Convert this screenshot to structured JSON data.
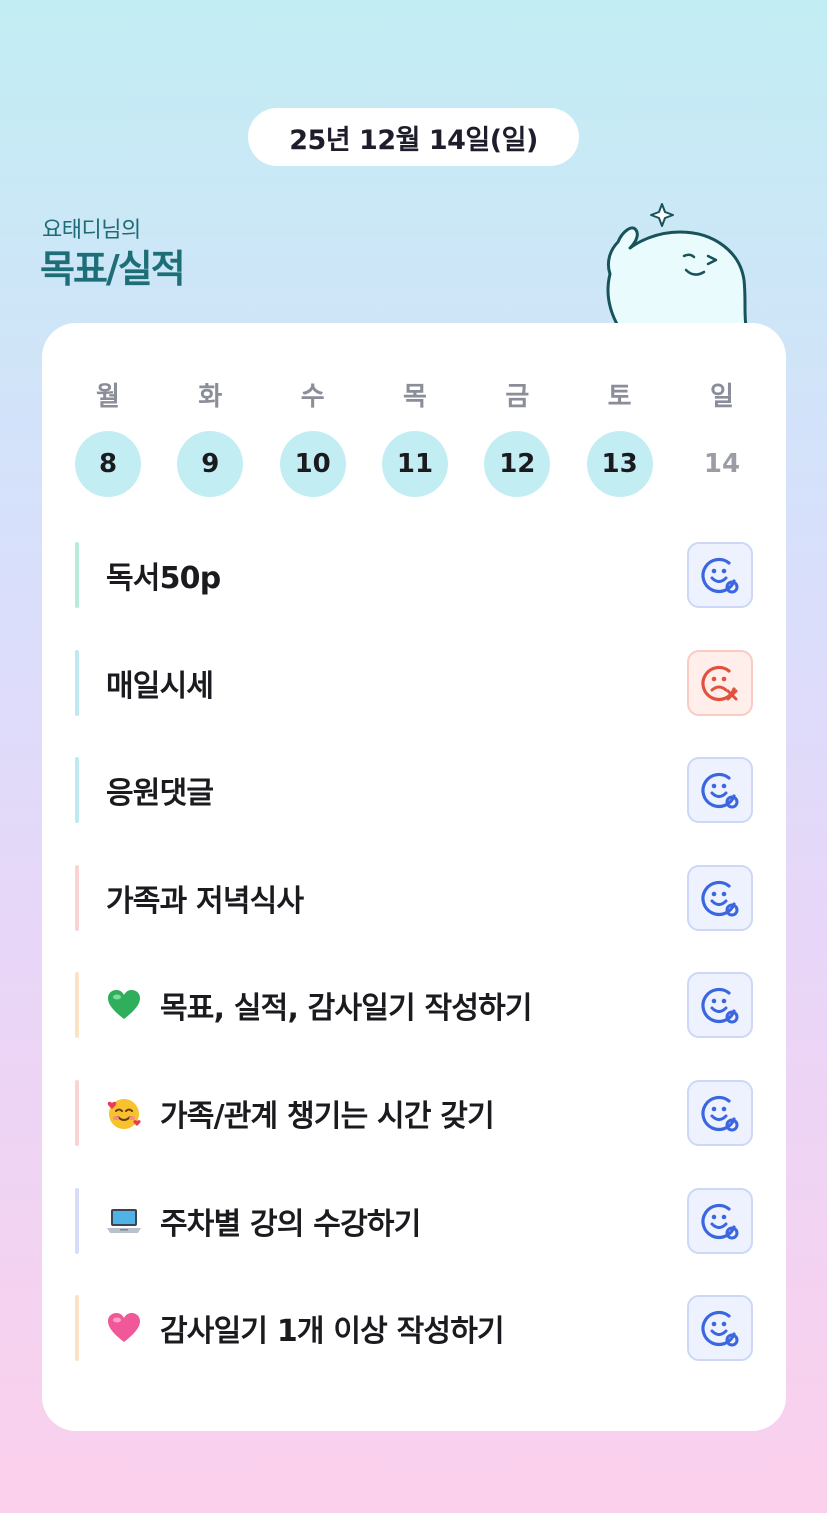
{
  "header": {
    "date": "25년 12월 14일(일)",
    "subtitle": "요태디님의",
    "title": "목표/실적"
  },
  "week": [
    {
      "label": "월",
      "num": "8",
      "state": "done"
    },
    {
      "label": "화",
      "num": "9",
      "state": "done"
    },
    {
      "label": "수",
      "num": "10",
      "state": "done"
    },
    {
      "label": "목",
      "num": "11",
      "state": "done"
    },
    {
      "label": "금",
      "num": "12",
      "state": "done"
    },
    {
      "label": "토",
      "num": "13",
      "state": "done"
    },
    {
      "label": "일",
      "num": "14",
      "state": "today"
    }
  ],
  "goals": [
    {
      "text": "독서50p",
      "emoji": null,
      "bar_color": "#b7ecd8",
      "status": "ok"
    },
    {
      "text": "매일시세",
      "emoji": null,
      "bar_color": "#bde9f0",
      "status": "fail"
    },
    {
      "text": "응원댓글",
      "emoji": null,
      "bar_color": "#bde9f0",
      "status": "ok"
    },
    {
      "text": "가족과 저녁식사",
      "emoji": null,
      "bar_color": "#fbd3d3",
      "status": "ok"
    },
    {
      "text": "목표, 실적, 감사일기 작성하기",
      "emoji": "green-heart-icon",
      "bar_color": "#fde3c3",
      "status": "ok"
    },
    {
      "text": "가족/관계 챙기는 시간 갖기",
      "emoji": "smiling-face-with-hearts-icon",
      "bar_color": "#fbd3d3",
      "status": "ok"
    },
    {
      "text": "주차별 강의 수강하기",
      "emoji": "laptop-icon",
      "bar_color": "#d7dcf8",
      "status": "ok"
    },
    {
      "text": "감사일기 1개 이상 작성하기",
      "emoji": "pink-heart-icon",
      "bar_color": "#fde3c3",
      "status": "ok"
    }
  ],
  "colors": {
    "accent_teal": "#1e6e78",
    "done_circle": "#c2eef3",
    "ok_icon": "#3a66e0",
    "fail_icon": "#e2503e"
  }
}
